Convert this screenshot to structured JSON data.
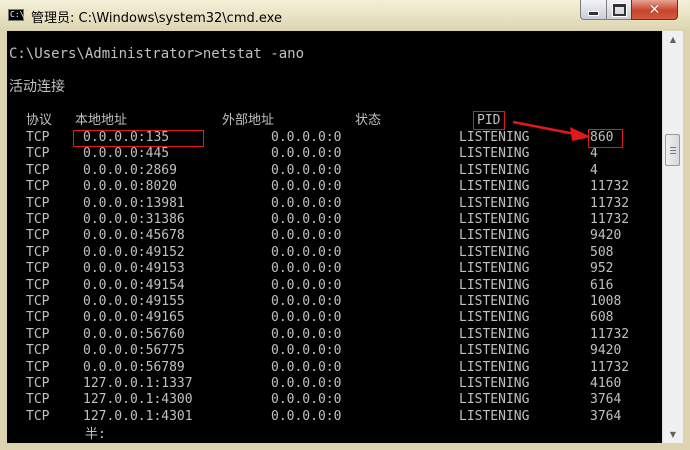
{
  "window": {
    "title": "管理员: C:\\Windows\\system32\\cmd.exe",
    "icon": "cmd-icon",
    "icon_glyph": "C:\\",
    "controls": {
      "minimize": "minimize-icon",
      "maximize": "maximize-icon",
      "close": "close-icon",
      "close_glyph": "✕"
    }
  },
  "console": {
    "prompt_line": "C:\\Users\\Administrator>netstat -ano",
    "section_title": "活动连接",
    "headers": {
      "proto": "协议",
      "local": "本地地址",
      "foreign": "外部地址",
      "state": "状态",
      "pid": "PID"
    },
    "rows": [
      {
        "proto": "TCP",
        "local": "0.0.0.0:135",
        "foreign": "0.0.0.0:0",
        "state": "LISTENING",
        "pid": "860"
      },
      {
        "proto": "TCP",
        "local": "0.0.0.0:445",
        "foreign": "0.0.0.0:0",
        "state": "LISTENING",
        "pid": "4"
      },
      {
        "proto": "TCP",
        "local": "0.0.0.0:2869",
        "foreign": "0.0.0.0:0",
        "state": "LISTENING",
        "pid": "4"
      },
      {
        "proto": "TCP",
        "local": "0.0.0.0:8020",
        "foreign": "0.0.0.0:0",
        "state": "LISTENING",
        "pid": "11732"
      },
      {
        "proto": "TCP",
        "local": "0.0.0.0:13981",
        "foreign": "0.0.0.0:0",
        "state": "LISTENING",
        "pid": "11732"
      },
      {
        "proto": "TCP",
        "local": "0.0.0.0:31386",
        "foreign": "0.0.0.0:0",
        "state": "LISTENING",
        "pid": "11732"
      },
      {
        "proto": "TCP",
        "local": "0.0.0.0:45678",
        "foreign": "0.0.0.0:0",
        "state": "LISTENING",
        "pid": "9420"
      },
      {
        "proto": "TCP",
        "local": "0.0.0.0:49152",
        "foreign": "0.0.0.0:0",
        "state": "LISTENING",
        "pid": "508"
      },
      {
        "proto": "TCP",
        "local": "0.0.0.0:49153",
        "foreign": "0.0.0.0:0",
        "state": "LISTENING",
        "pid": "952"
      },
      {
        "proto": "TCP",
        "local": "0.0.0.0:49154",
        "foreign": "0.0.0.0:0",
        "state": "LISTENING",
        "pid": "616"
      },
      {
        "proto": "TCP",
        "local": "0.0.0.0:49155",
        "foreign": "0.0.0.0:0",
        "state": "LISTENING",
        "pid": "1008"
      },
      {
        "proto": "TCP",
        "local": "0.0.0.0:49165",
        "foreign": "0.0.0.0:0",
        "state": "LISTENING",
        "pid": "608"
      },
      {
        "proto": "TCP",
        "local": "0.0.0.0:56760",
        "foreign": "0.0.0.0:0",
        "state": "LISTENING",
        "pid": "11732"
      },
      {
        "proto": "TCP",
        "local": "0.0.0.0:56775",
        "foreign": "0.0.0.0:0",
        "state": "LISTENING",
        "pid": "9420"
      },
      {
        "proto": "TCP",
        "local": "0.0.0.0:56789",
        "foreign": "0.0.0.0:0",
        "state": "LISTENING",
        "pid": "11732"
      },
      {
        "proto": "TCP",
        "local": "127.0.0.1:1337",
        "foreign": "0.0.0.0:0",
        "state": "LISTENING",
        "pid": "4160"
      },
      {
        "proto": "TCP",
        "local": "127.0.0.1:4300",
        "foreign": "0.0.0.0:0",
        "state": "LISTENING",
        "pid": "3764"
      },
      {
        "proto": "TCP",
        "local": "127.0.0.1:4301",
        "foreign": "0.0.0.0:0",
        "state": "LISTENING",
        "pid": "3764"
      }
    ],
    "partial_line": "半:"
  },
  "annotations": {
    "color": "#e0191b"
  },
  "scrollbar": {
    "up_icon": "scroll-up-arrow-icon",
    "down_icon": "scroll-down-arrow-icon",
    "up_glyph": "▲",
    "down_glyph": "▼"
  }
}
